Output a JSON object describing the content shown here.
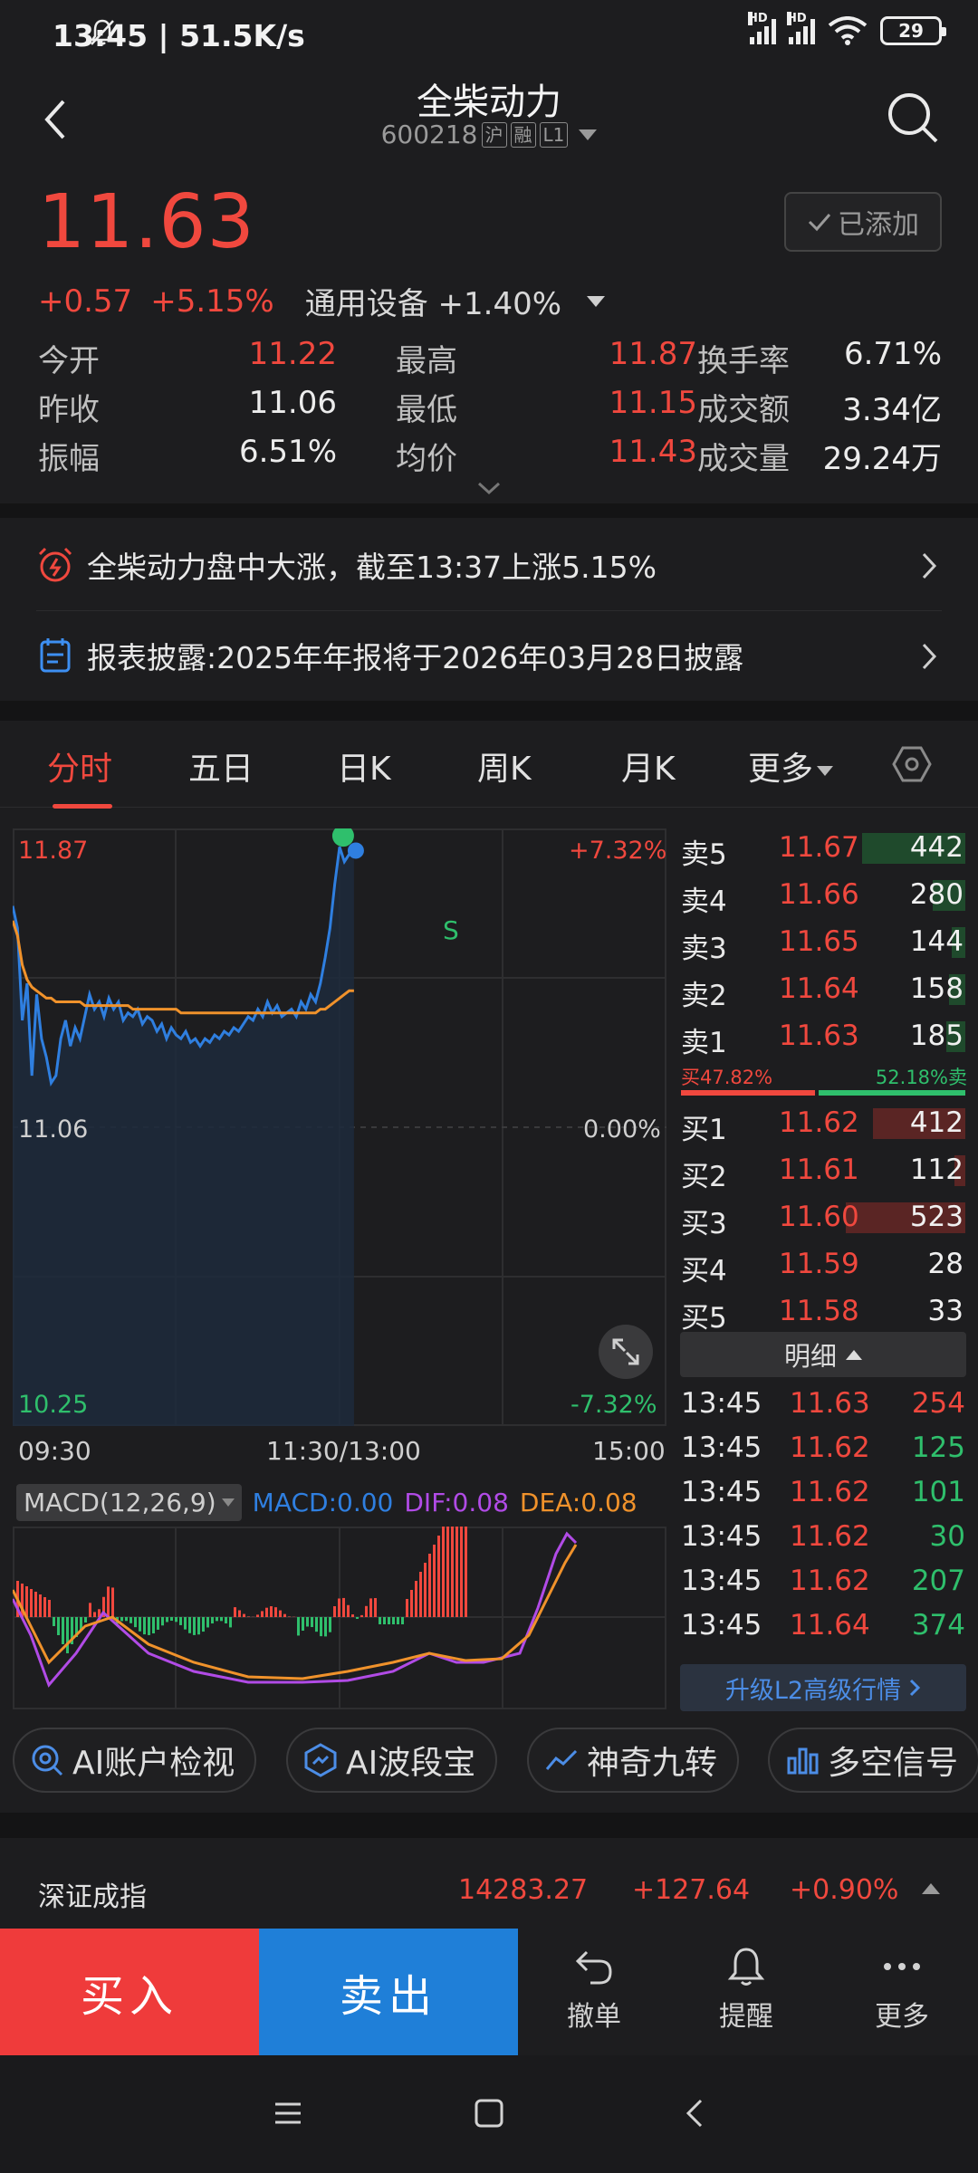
{
  "status": {
    "time": "13:45 | 51.5K/s",
    "hd1": "HD",
    "hd2": "HD",
    "battery": "29"
  },
  "header": {
    "title": "全柴动力",
    "code": "600218",
    "tags": [
      "沪",
      "融",
      "L1"
    ]
  },
  "quote": {
    "price": "11.63",
    "change": "+0.57",
    "change_pct": "+5.15%",
    "industry": "通用设备 +1.40%",
    "added_label": "已添加"
  },
  "stats": [
    [
      {
        "label": "今开",
        "value": "11.22",
        "color": "red"
      },
      {
        "label": "最高",
        "value": "11.87",
        "color": "red"
      },
      {
        "label": "换手率",
        "value": "6.71%",
        "color": "white"
      }
    ],
    [
      {
        "label": "昨收",
        "value": "11.06",
        "color": "white"
      },
      {
        "label": "最低",
        "value": "11.15",
        "color": "red"
      },
      {
        "label": "成交额",
        "value": "3.34亿",
        "color": "white"
      }
    ],
    [
      {
        "label": "振幅",
        "value": "6.51%",
        "color": "white"
      },
      {
        "label": "均价",
        "value": "11.43",
        "color": "red"
      },
      {
        "label": "成交量",
        "value": "29.24万",
        "color": "white"
      }
    ]
  ],
  "notices": {
    "alert": "全柴动力盘中大涨，截至13:37上涨5.15%",
    "report": "报表披露:2025年年报将于2026年03月28日披露"
  },
  "tabs": [
    "分时",
    "五日",
    "日K",
    "周K",
    "月K",
    "更多"
  ],
  "chart": {
    "y_high": "11.87",
    "y_mid": "11.06",
    "y_low": "10.25",
    "pct_high": "+7.32%",
    "pct_mid": "0.00%",
    "pct_low": "-7.32%",
    "t_start": "09:30",
    "t_mid": "11:30/13:00",
    "t_end": "15:00",
    "marker": "S",
    "colors": {
      "price": "#2f7fe0",
      "avg": "#f0922b",
      "up": "#f0483e",
      "down": "#2fbf6c"
    }
  },
  "chart_data": {
    "type": "line",
    "ylim": [
      10.25,
      11.87
    ],
    "series": [
      {
        "values": [
          11.66,
          11.6,
          11.35,
          11.45,
          11.2,
          11.42,
          11.3,
          11.25,
          11.18,
          11.2,
          11.3,
          11.35,
          11.28,
          11.33,
          11.3,
          11.36,
          11.42,
          11.38,
          11.4,
          11.36,
          11.41,
          11.38,
          11.4,
          11.35,
          11.37,
          11.36,
          11.38,
          11.34,
          11.36,
          11.35,
          11.32,
          11.34,
          11.3,
          11.33,
          11.31,
          11.3,
          11.32,
          11.29,
          11.3,
          11.28,
          11.3,
          11.29,
          11.31,
          11.3,
          11.32,
          11.31,
          11.33,
          11.32,
          11.34,
          11.36,
          11.35,
          11.38,
          11.36,
          11.4,
          11.37,
          11.39,
          11.36,
          11.37,
          11.38,
          11.36,
          11.4,
          11.38,
          11.42,
          11.4,
          11.45,
          11.52,
          11.6,
          11.72,
          11.82,
          11.78,
          11.8,
          11.81
        ]
      },
      {
        "values": [
          11.62,
          11.58,
          11.5,
          11.46,
          11.44,
          11.43,
          11.42,
          11.41,
          11.41,
          11.4,
          11.4,
          11.4,
          11.4,
          11.4,
          11.4,
          11.39,
          11.39,
          11.39,
          11.39,
          11.39,
          11.39,
          11.39,
          11.39,
          11.39,
          11.39,
          11.38,
          11.38,
          11.38,
          11.38,
          11.38,
          11.38,
          11.38,
          11.38,
          11.38,
          11.38,
          11.37,
          11.37,
          11.37,
          11.37,
          11.37,
          11.37,
          11.37,
          11.37,
          11.37,
          11.37,
          11.37,
          11.37,
          11.37,
          11.37,
          11.37,
          11.37,
          11.37,
          11.37,
          11.37,
          11.37,
          11.37,
          11.37,
          11.37,
          11.37,
          11.37,
          11.37,
          11.37,
          11.37,
          11.37,
          11.38,
          11.38,
          11.39,
          11.4,
          11.41,
          11.42,
          11.43,
          11.43
        ]
      }
    ]
  },
  "macd": {
    "selector": "MACD(12,26,9)",
    "macd": "MACD:0.00",
    "dif": "DIF:0.08",
    "dea": "DEA:0.08"
  },
  "orderbook": {
    "sell": [
      {
        "label": "卖5",
        "price": "11.67",
        "vol": "442",
        "pct": 0.38
      },
      {
        "label": "卖4",
        "price": "11.66",
        "vol": "280",
        "pct": 0.12
      },
      {
        "label": "卖3",
        "price": "11.65",
        "vol": "144",
        "pct": 0.05
      },
      {
        "label": "卖2",
        "price": "11.64",
        "vol": "158",
        "pct": 0.06
      },
      {
        "label": "卖1",
        "price": "11.63",
        "vol": "185",
        "pct": 0.07
      }
    ],
    "ratio_buy": "买47.82%",
    "ratio_sell": "52.18%卖",
    "buy": [
      {
        "label": "买1",
        "price": "11.62",
        "vol": "412",
        "pct": 0.34
      },
      {
        "label": "买2",
        "price": "11.61",
        "vol": "112",
        "pct": 0.04
      },
      {
        "label": "买3",
        "price": "11.60",
        "vol": "523",
        "pct": 0.44
      },
      {
        "label": "买4",
        "price": "11.59",
        "vol": "28",
        "pct": 0.0
      },
      {
        "label": "买5",
        "price": "11.58",
        "vol": "33",
        "pct": 0.0
      }
    ],
    "detail_label": "明细",
    "ticks": [
      {
        "time": "13:45",
        "price": "11.63",
        "vol": "254",
        "dir": "red"
      },
      {
        "time": "13:45",
        "price": "11.62",
        "vol": "125",
        "dir": "green"
      },
      {
        "time": "13:45",
        "price": "11.62",
        "vol": "101",
        "dir": "green"
      },
      {
        "time": "13:45",
        "price": "11.62",
        "vol": "30",
        "dir": "green"
      },
      {
        "time": "13:45",
        "price": "11.62",
        "vol": "207",
        "dir": "green"
      },
      {
        "time": "13:45",
        "price": "11.64",
        "vol": "374",
        "dir": "green"
      }
    ],
    "upgrade_label": "升级L2高级行情"
  },
  "chips": [
    "AI账户检视",
    "AI波段宝",
    "神奇九转",
    "多空信号"
  ],
  "index": {
    "name": "深证成指",
    "value": "14283.27",
    "change": "+127.64",
    "pct": "+0.90%"
  },
  "actions": {
    "buy": "买入",
    "sell": "卖出",
    "cancel": "撤单",
    "alert": "提醒",
    "more": "更多"
  }
}
